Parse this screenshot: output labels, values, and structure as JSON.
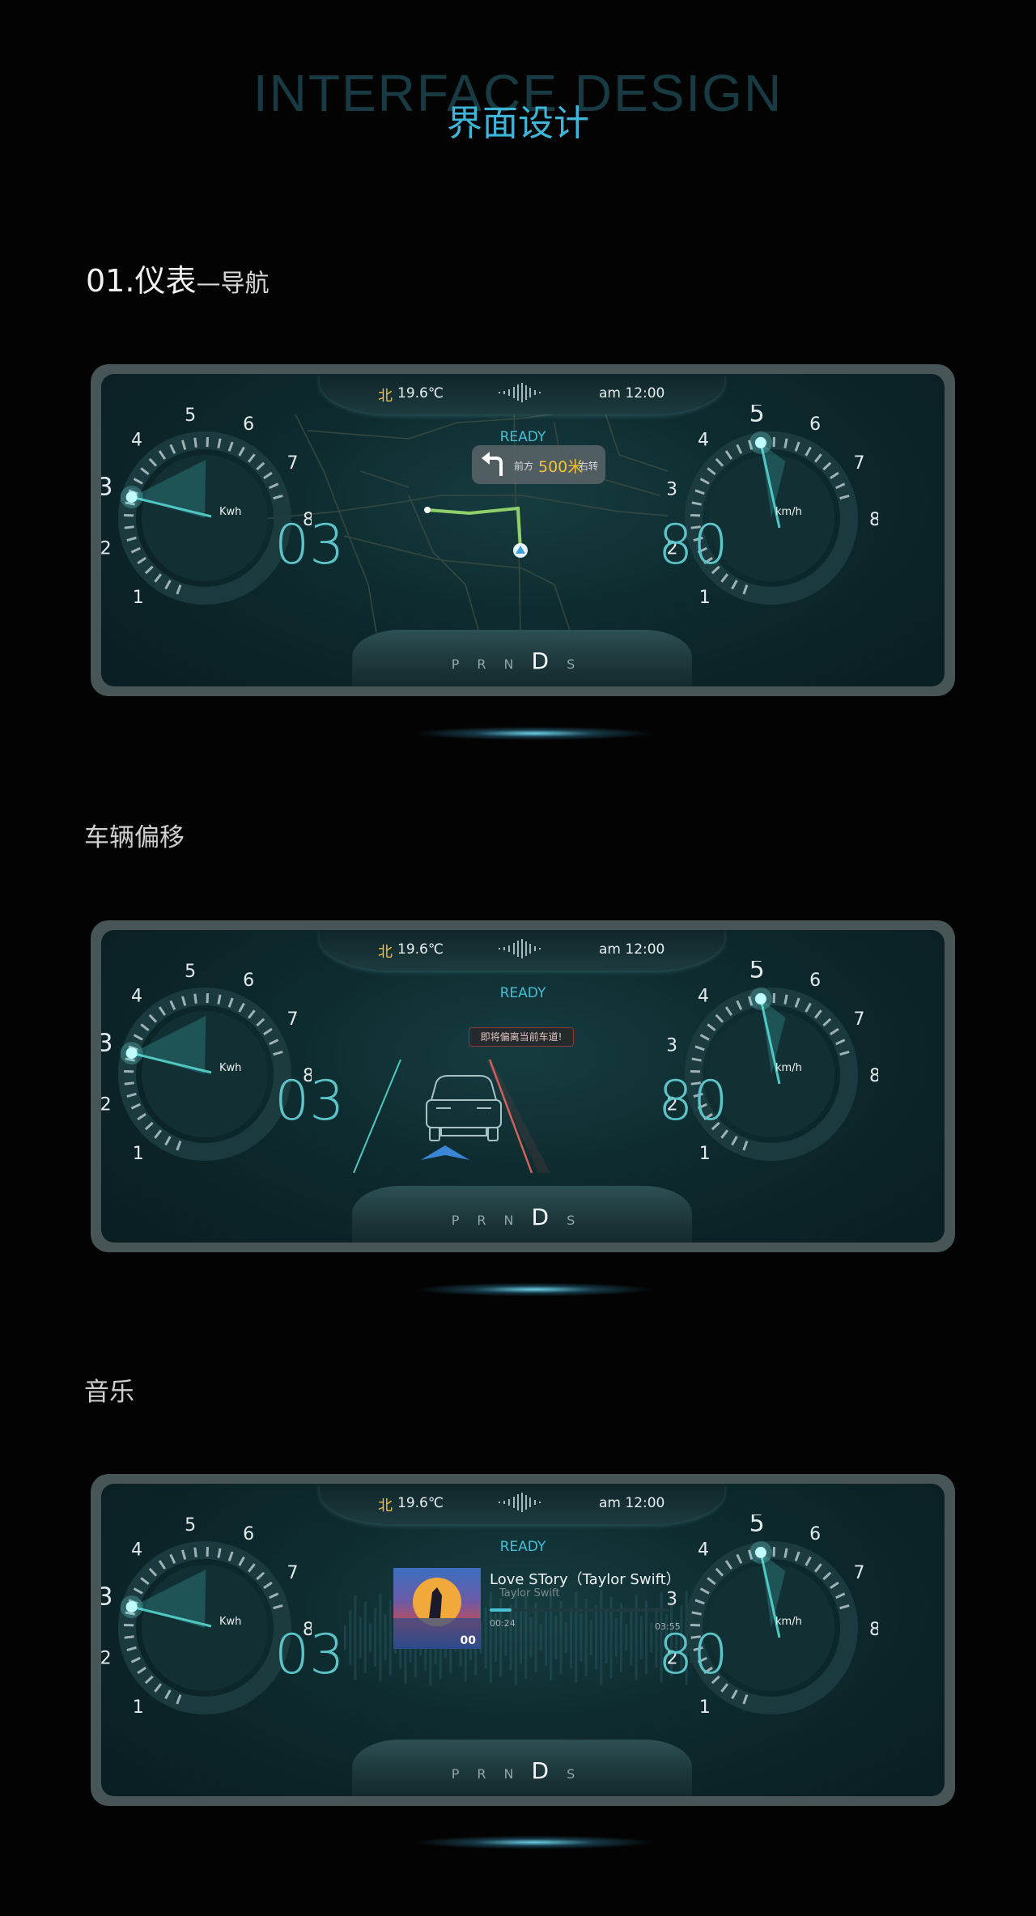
{
  "header": {
    "title_en": "INTERFACE DESIGN",
    "title_cn": "界面设计"
  },
  "sections": [
    {
      "num": "01.",
      "title": "仪表",
      "dash": "—",
      "subtitle": "导航"
    },
    {
      "title": "车辆偏移"
    },
    {
      "title": "音乐"
    }
  ],
  "status": {
    "direction": "北",
    "temperature": "19.6℃",
    "time": "am  12:00",
    "ready": "READY"
  },
  "energy_gauge": {
    "ticks": [
      "1",
      "2",
      "3",
      "4",
      "5",
      "6",
      "7",
      "8"
    ],
    "unit": "Kwh",
    "value": "03",
    "current_tick": "3"
  },
  "speed_gauge": {
    "ticks": [
      "1",
      "2",
      "3",
      "4",
      "5",
      "6",
      "7",
      "8"
    ],
    "unit": "km/h",
    "value": "80",
    "current_tick": "5"
  },
  "gears": {
    "items": [
      "P",
      "R",
      "N",
      "D",
      "S"
    ],
    "selected": "D"
  },
  "navigation": {
    "prefix": "前方",
    "distance": "500米",
    "action": "右转"
  },
  "lane_warning": {
    "text": "即将偏离当前车道!"
  },
  "music": {
    "song": "Love  STory（Taylor Swift）",
    "artist": "Taylor  Swift",
    "cover_badge": "00",
    "elapsed": "00:24",
    "duration": "03:55",
    "progress": 0.12
  },
  "colors": {
    "accent": "#46bfd6",
    "gauge_value": "#5cc4c8",
    "warning": "#c65a52",
    "nav_route": "#8fd06a",
    "highlight": "#f4c435"
  }
}
